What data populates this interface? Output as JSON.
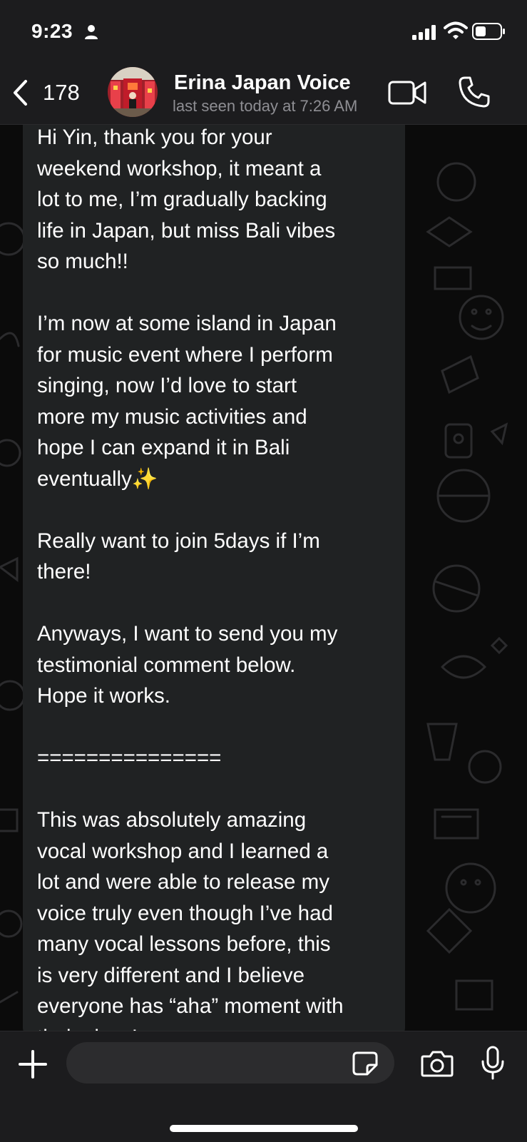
{
  "status_bar": {
    "time": "9:23",
    "icons": [
      "person-icon",
      "signal-icon",
      "wifi-icon",
      "battery-icon"
    ]
  },
  "header": {
    "back_count": "178",
    "contact_name": "Erina Japan Voice",
    "last_seen": "last seen today at 7:26 AM",
    "icons": [
      "back-chevron-icon",
      "video-call-icon",
      "phone-call-icon"
    ]
  },
  "message": {
    "text": "Hi Yin, thank you for your\nweekend workshop, it meant a\nlot to me, I’m gradually backing\nlife in Japan, but miss Bali vibes\nso much!!\n\nI’m now at some island in Japan\nfor music event where I perform\nsinging, now I’d love to start\nmore my music activities and\nhope I can expand it in Bali\neventually✨\n\nReally want to join 5days if I’m\nthere!\n\nAnyways, I want to send you my\ntestimonial comment below.\nHope it works.\n\n===============\n\nThis was absolutely amazing\nvocal workshop and I learned a\nlot and were able to release my\nvoice truly even though I’ve had\nmany vocal lessons before, this\nis very different and I believe\neveryone has “aha” moment with\ntheir class!"
  },
  "input_bar": {
    "placeholder": "",
    "icons": [
      "plus-icon",
      "sticker-icon",
      "camera-icon",
      "microphone-icon"
    ]
  },
  "colors": {
    "bar_background": "#1c1c1e",
    "chat_background": "#0b0b0b",
    "bubble_background": "#202223",
    "input_background": "#2c2c2e",
    "secondary_text": "#8e8e93"
  }
}
